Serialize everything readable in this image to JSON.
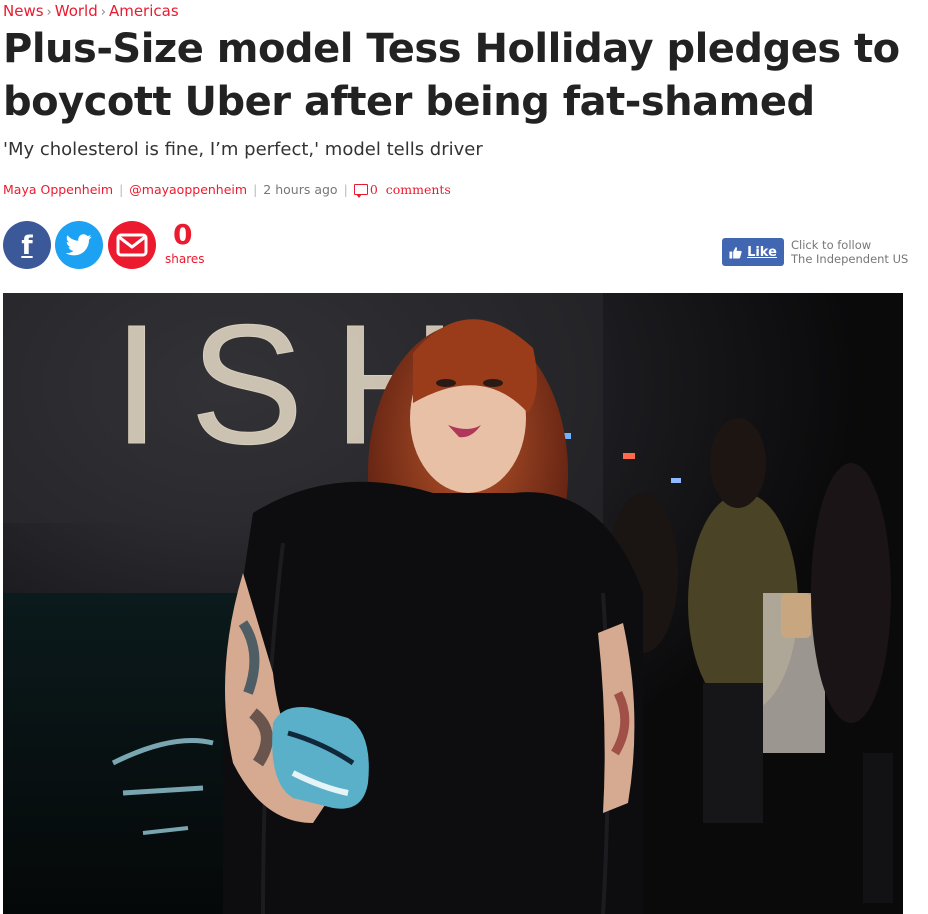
{
  "breadcrumb": {
    "items": [
      "News",
      "World",
      "Americas"
    ],
    "separator": "›"
  },
  "article": {
    "headline_line1": "Plus-Size model Tess Holliday pledges to",
    "headline_line2": "boycott Uber after being fat-shamed",
    "standfirst": "'My cholesterol is fine, I’m perfect,' model tells driver",
    "author": "Maya Oppenheim",
    "twitter_handle": "@mayaoppenheim",
    "timestamp": "2 hours ago",
    "comments_count": "0",
    "comments_label": "comments"
  },
  "share": {
    "count": "0",
    "count_label": "shares",
    "buttons": [
      {
        "network": "facebook",
        "icon": "facebook-icon",
        "color": "#3b5998"
      },
      {
        "network": "twitter",
        "icon": "twitter-icon",
        "color": "#1da1f2"
      },
      {
        "network": "email",
        "icon": "email-icon",
        "color": "#ec1a2e"
      }
    ]
  },
  "follow": {
    "like_label": "Like",
    "line1": "Click to follow",
    "line2": "The Independent US"
  },
  "photo": {
    "backdrop_text": "ISH",
    "description_icon": "hero-photo"
  },
  "colors": {
    "accent": "#ec1a2e",
    "facebook": "#3b5998",
    "twitter": "#1da1f2",
    "like": "#4267b2"
  }
}
